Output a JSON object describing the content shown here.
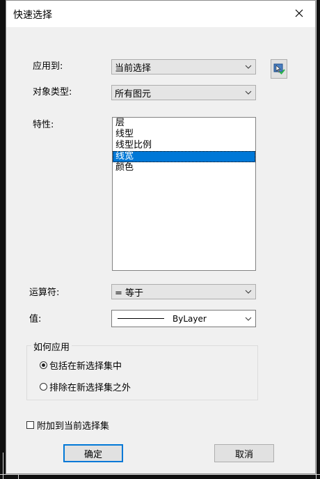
{
  "dialog": {
    "title": "快速选择"
  },
  "apply_to": {
    "label": "应用到:",
    "value": "当前选择"
  },
  "object_type": {
    "label": "对象类型:",
    "value": "所有图元"
  },
  "properties": {
    "label": "特性:",
    "items": [
      "层",
      "线型",
      "线型比例",
      "线宽",
      "颜色"
    ],
    "selected_index": 3
  },
  "operator": {
    "label": "运算符:",
    "value": "= 等于"
  },
  "value": {
    "label": "值:",
    "value": "ByLayer"
  },
  "how_to_apply": {
    "title": "如何应用",
    "include_label": "包括在新选择集中",
    "exclude_label": "排除在新选择集之外",
    "selected": "include"
  },
  "append": {
    "label": "附加到当前选择集",
    "checked": false
  },
  "buttons": {
    "ok": "确定",
    "cancel": "取消"
  },
  "colors": {
    "selection": "#0078d7",
    "dialog_bg": "#f0f0f0"
  }
}
